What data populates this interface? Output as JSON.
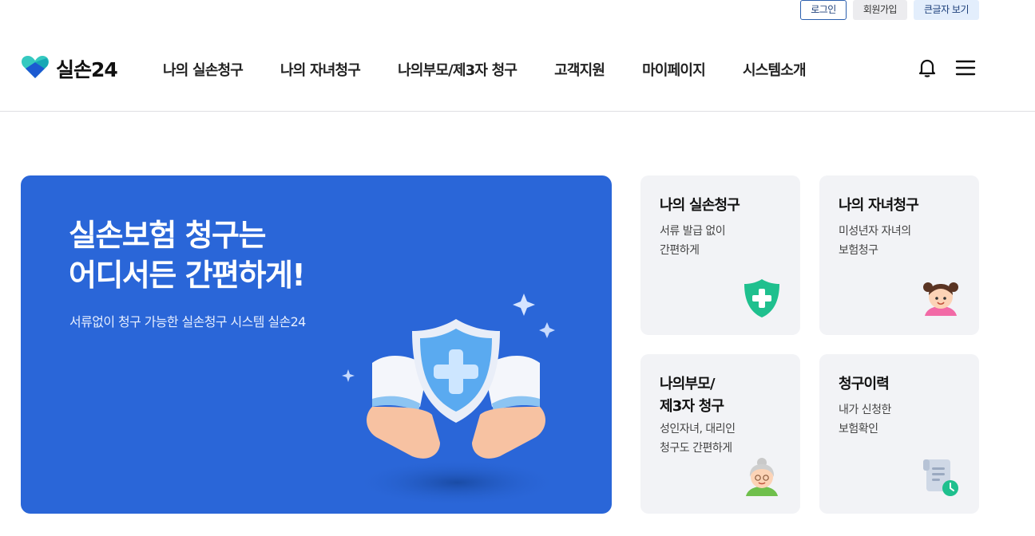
{
  "util": {
    "login": "로그인",
    "join": "회원가입",
    "big_text": "큰글자 보기"
  },
  "logo": {
    "text": "실손24",
    "icon": "heart-logo-icon"
  },
  "nav": [
    "나의 실손청구",
    "나의 자녀청구",
    "나의부모/제3자 청구",
    "고객지원",
    "마이페이지",
    "시스템소개"
  ],
  "header_icons": [
    "bell-icon",
    "menu-icon"
  ],
  "hero": {
    "title_line1": "실손보험 청구는",
    "title_line2": "어디서든 간편하게!",
    "subtitle": "서류없이 청구 가능한 실손청구 시스템 실손24",
    "image": "hands-holding-shield-icon"
  },
  "cards": [
    {
      "title1": "나의 실손청구",
      "title2": "",
      "desc1": "서류 발급 없이",
      "desc2": "간편하게",
      "icon": "green-shield-plus-icon"
    },
    {
      "title1": "나의 자녀청구",
      "title2": "",
      "desc1": "미성년자 자녀의",
      "desc2": "보험청구",
      "icon": "child-girl-icon"
    },
    {
      "title1": "나의부모/",
      "title2": "제3자 청구",
      "desc1": "성인자녀, 대리인",
      "desc2": "청구도 간편하게",
      "icon": "grandmother-icon"
    },
    {
      "title1": "청구이력",
      "title2": "",
      "desc1": "내가 신청한",
      "desc2": "보험확인",
      "icon": "document-clock-icon"
    }
  ],
  "colors": {
    "brand_blue": "#2a66d8",
    "accent_green": "#1fc08e",
    "card_bg": "#f2f3f6"
  }
}
